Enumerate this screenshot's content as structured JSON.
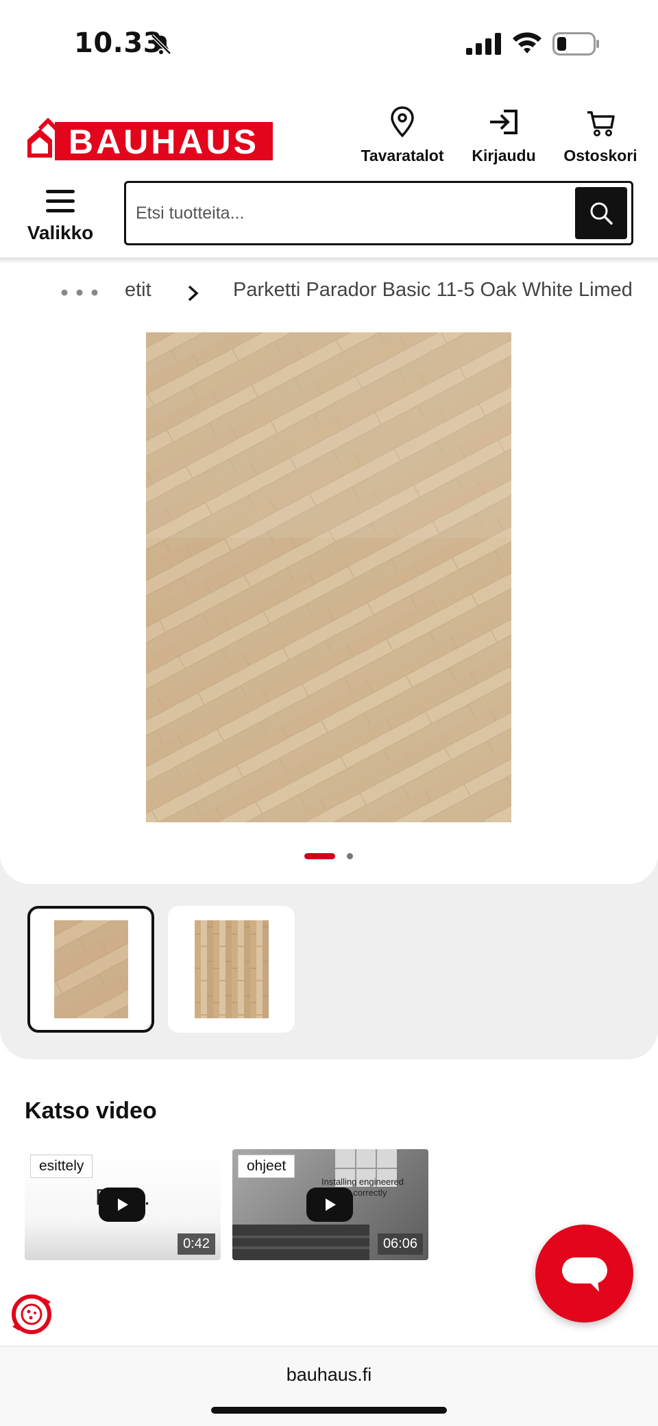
{
  "status_bar": {
    "time": "10.33"
  },
  "header": {
    "logo_text": "BAUHAUS",
    "stores_label": "Tavaratalot",
    "login_label": "Kirjaudu",
    "cart_label": "Ostoskori",
    "menu_label": "Valikko",
    "search_placeholder": "Etsi tuotteita..."
  },
  "breadcrumb": {
    "previous": "etit",
    "current": "Parketti Parador Basic 11-5 Oak White Limed"
  },
  "gallery": {
    "image_count": 2,
    "active_index": 0
  },
  "videos": {
    "title": "Katso video",
    "items": [
      {
        "tag": "esittely",
        "text": "Bui it.",
        "duration": "0:42"
      },
      {
        "tag": "ohjeet",
        "text": "Installing engineered flooring correctly",
        "duration": "06:06"
      }
    ]
  },
  "browser": {
    "url": "bauhaus.fi"
  },
  "colors": {
    "brand_red": "#e2051b",
    "black": "#111111"
  }
}
